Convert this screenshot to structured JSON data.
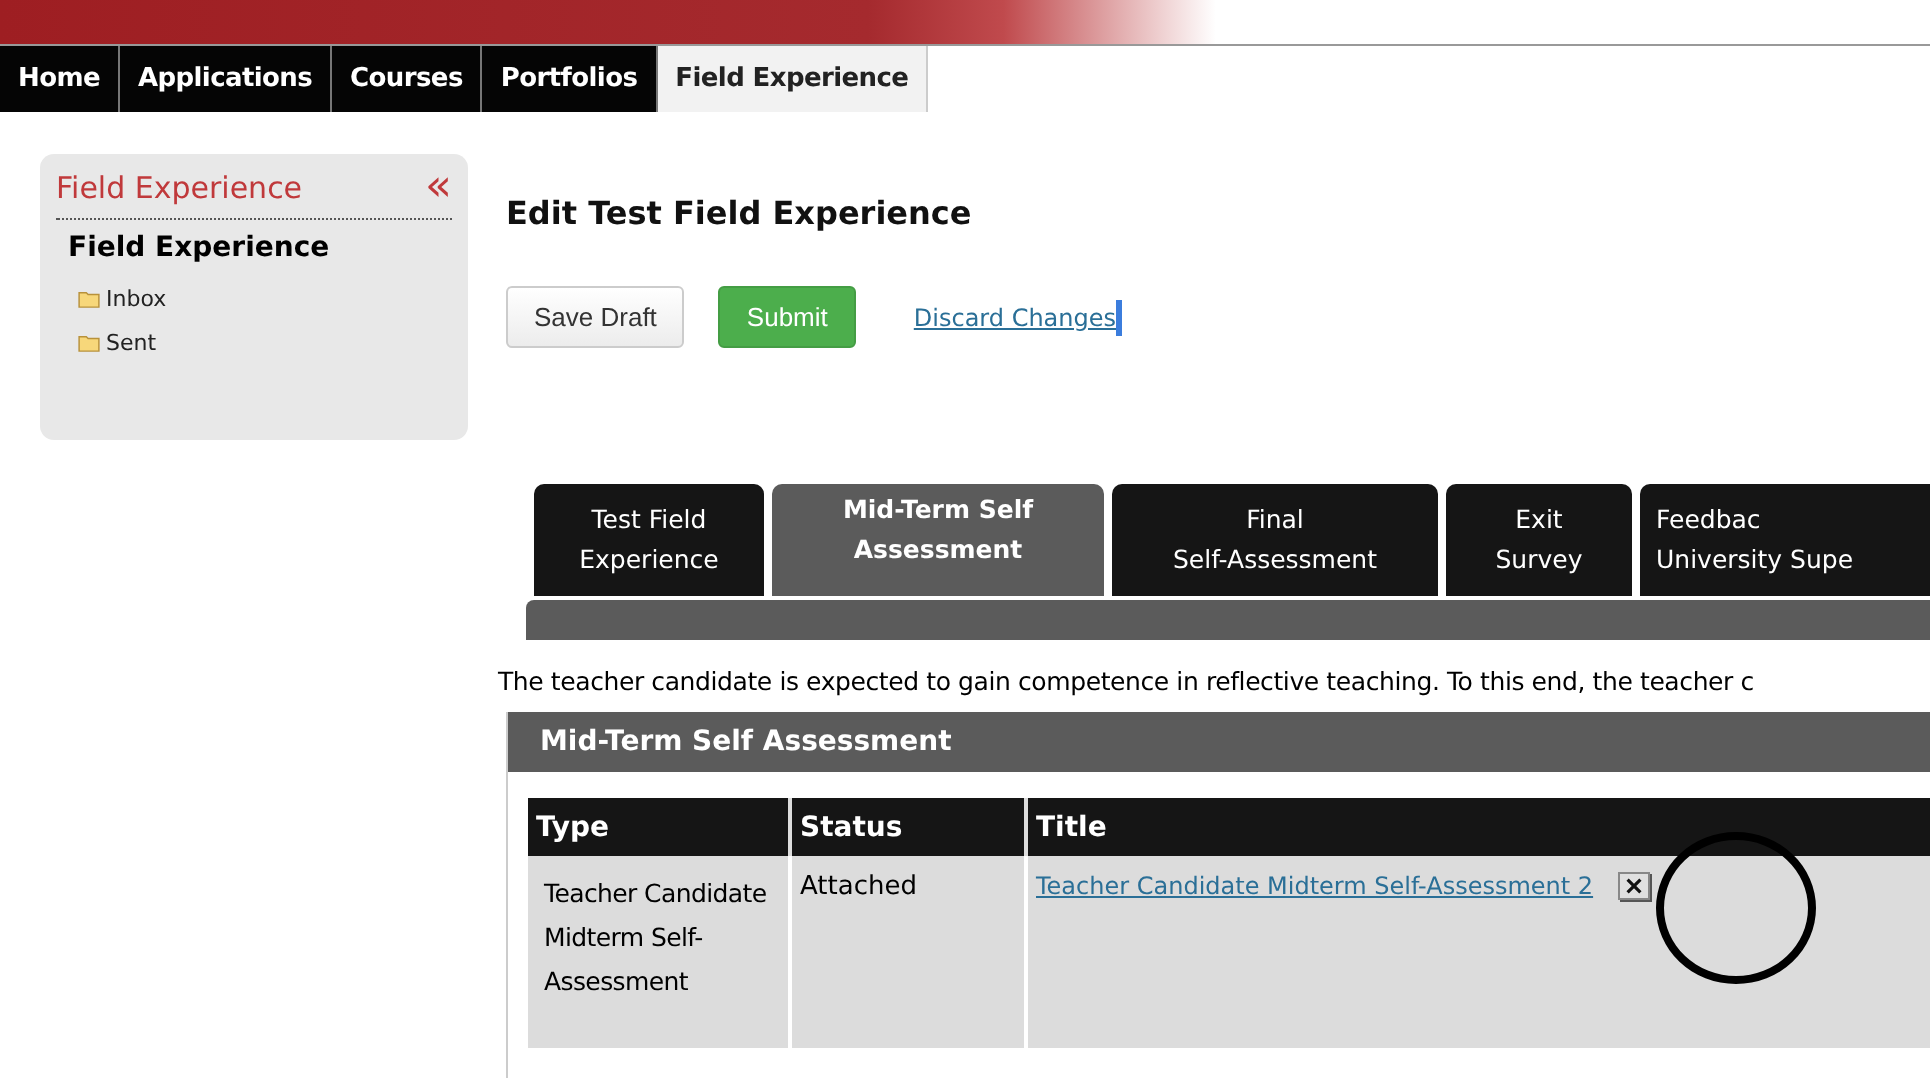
{
  "nav": {
    "items": [
      {
        "label": "Home",
        "selected": false
      },
      {
        "label": "Applications",
        "selected": false
      },
      {
        "label": "Courses",
        "selected": false
      },
      {
        "label": "Portfolios",
        "selected": false
      },
      {
        "label": "Field Experience",
        "selected": true
      }
    ]
  },
  "sidebar": {
    "title": "Field Experience",
    "collapse": "«",
    "section": "Field Experience",
    "items": [
      {
        "label": "Inbox"
      },
      {
        "label": "Sent"
      }
    ]
  },
  "page_title": "Edit Test Field Experience",
  "actions": [
    {
      "kind": "button",
      "label": "Save Draft"
    },
    {
      "kind": "primary",
      "label": "Submit"
    },
    {
      "kind": "link",
      "label": "Discard Changes",
      "caret": true
    }
  ],
  "tabs": [
    {
      "label": "Test Field\nExperience",
      "selected": false
    },
    {
      "label": "Mid-Term Self\nAssessment",
      "selected": true
    },
    {
      "label": "Final\nSelf-Assessment",
      "selected": false
    },
    {
      "label": "Exit\nSurvey",
      "selected": false
    },
    {
      "label": "Feedbac\nUniversity Supe",
      "selected": false
    }
  ],
  "description": "The teacher candidate is expected to gain competence in reflective teaching. To this end, the teacher c",
  "panel": {
    "title": "Mid-Term Self Assessment",
    "table": {
      "columns": [
        "Type",
        "Status",
        "Title"
      ],
      "rows": [
        {
          "type": "Teacher Candidate Midterm Self-Assessment",
          "status": "Attached",
          "title": "Teacher Candidate Midterm Self-Assessment 2",
          "removable": true,
          "circled": true
        }
      ]
    }
  }
}
